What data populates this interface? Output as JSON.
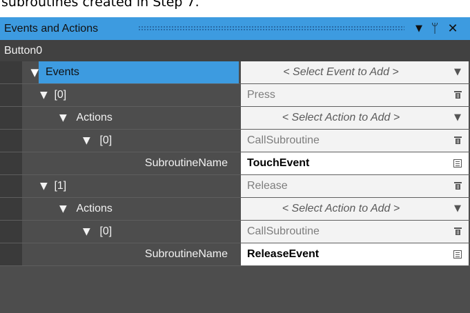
{
  "caption": "subroutines created in Step 7.",
  "panel": {
    "title": "Events and Actions",
    "buttons": {
      "dropdown": "▼",
      "pin": "ᛘ",
      "close": "✕"
    }
  },
  "target": "Button0",
  "colors": {
    "accent": "#3d9be0",
    "panel_bg": "#4d4d4d",
    "subtitle_bg": "#414141"
  },
  "rows": [
    {
      "name": "Events",
      "value": "< Select Event to Add >",
      "button_icon": "dropdown-arrow-icon",
      "expander": "▼"
    },
    {
      "name": "[0]",
      "value": "Press",
      "button_icon": "trash-icon",
      "expander": "▼"
    },
    {
      "name": "Actions",
      "value": "< Select Action to Add >",
      "button_icon": "dropdown-arrow-icon",
      "expander": "▼"
    },
    {
      "name": "[0]",
      "value": "CallSubroutine",
      "button_icon": "trash-icon",
      "expander": "▼"
    },
    {
      "name": "SubroutineName",
      "value": "TouchEvent",
      "button_icon": "edit-text-icon"
    },
    {
      "name": "[1]",
      "value": "Release",
      "button_icon": "trash-icon",
      "expander": "▼"
    },
    {
      "name": "Actions",
      "value": "< Select Action to Add >",
      "button_icon": "dropdown-arrow-icon",
      "expander": "▼"
    },
    {
      "name": "[0]",
      "value": "CallSubroutine",
      "button_icon": "trash-icon",
      "expander": "▼"
    },
    {
      "name": "SubroutineName",
      "value": "ReleaseEvent",
      "button_icon": "edit-text-icon"
    }
  ]
}
